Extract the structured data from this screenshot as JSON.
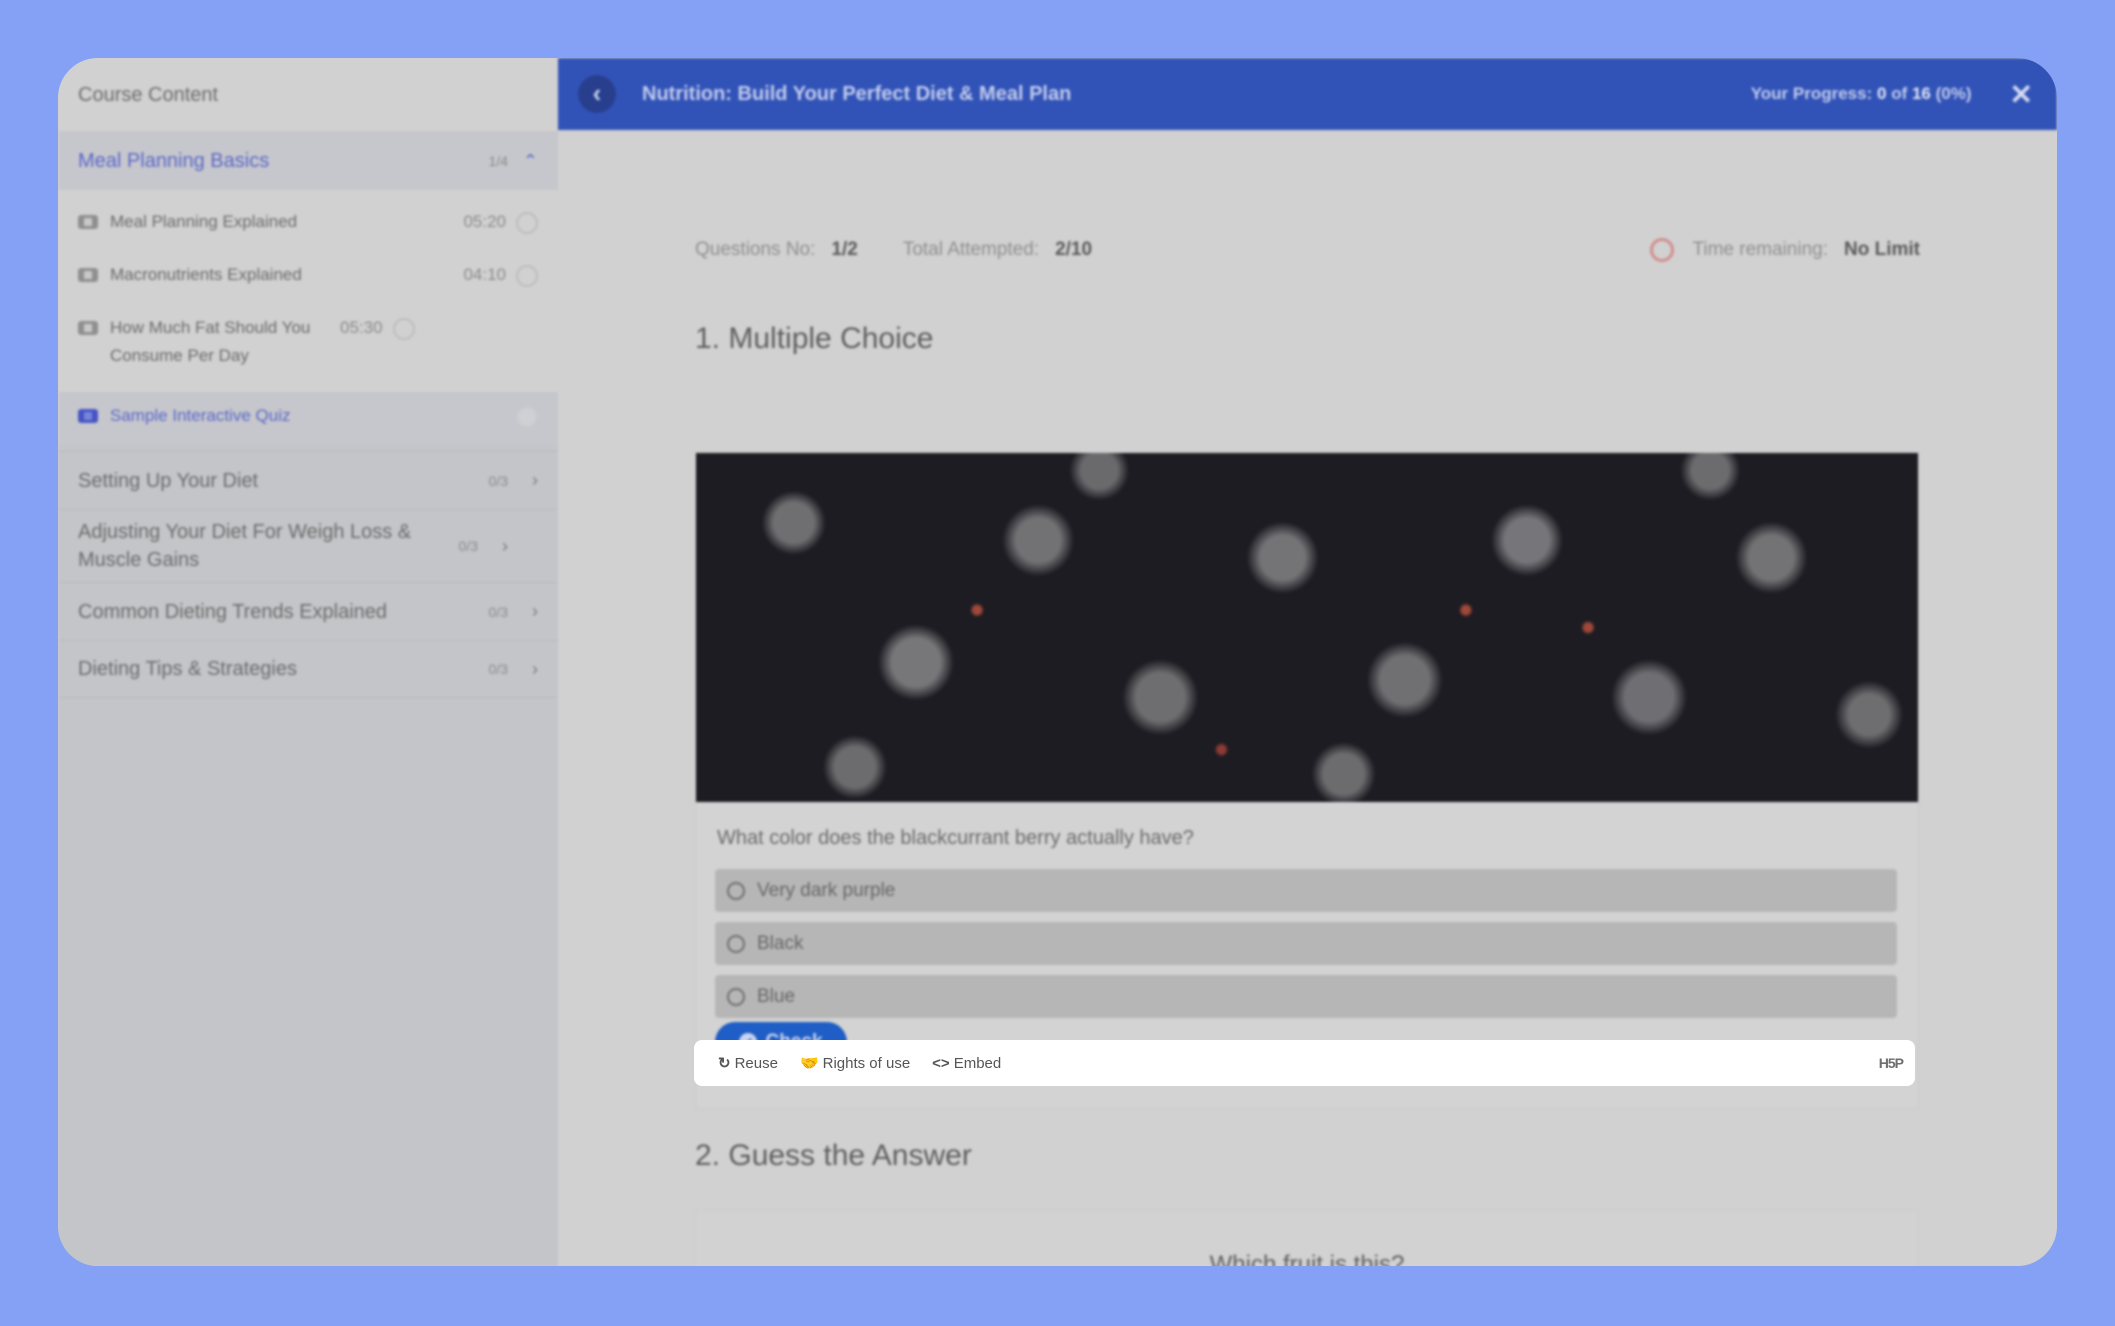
{
  "sidebar": {
    "title": "Course Content",
    "sections": [
      {
        "label": "Meal Planning Basics",
        "count": "1/4",
        "expanded": true,
        "items": [
          {
            "label": "Meal Planning Explained",
            "duration": "05:20",
            "icon": "video-icon"
          },
          {
            "label": "Macronutrients Explained",
            "duration": "04:10",
            "icon": "video-icon"
          },
          {
            "label": "How Much Fat Should You Consume Per Day",
            "duration": "05:30",
            "icon": "video-icon"
          },
          {
            "label": "Sample Interactive Quiz",
            "duration": "",
            "icon": "quiz-icon",
            "active": true
          }
        ]
      },
      {
        "label": "Setting Up Your Diet",
        "count": "0/3"
      },
      {
        "label": "Adjusting Your Diet For Weigh Loss & Muscle Gains",
        "count": "0/3"
      },
      {
        "label": "Common Dieting Trends Explained",
        "count": "0/3"
      },
      {
        "label": "Dieting Tips & Strategies",
        "count": "0/3"
      }
    ]
  },
  "header": {
    "title": "Nutrition: Build Your Perfect Diet & Meal Plan",
    "progress_label": "Your Progress:",
    "progress_done": "0",
    "progress_of": "of",
    "progress_total": "16",
    "progress_percent": "(0%)",
    "accent_color": "#3153b7"
  },
  "quiz": {
    "questions_label": "Questions No:",
    "questions_value": "1/2",
    "attempted_label": "Total Attempted:",
    "attempted_value": "2/10",
    "time_label": "Time remaining:",
    "time_value": "No Limit",
    "q1": {
      "title": "1. Multiple Choice",
      "image_alt": "blackcurrant berries",
      "question": "What color does the blackcurrant berry actually have?",
      "options": [
        "Very dark purple",
        "Black",
        "Blue"
      ],
      "check_label": "Check"
    },
    "h5p_footer": {
      "reuse": "Reuse",
      "rights": "Rights of use",
      "embed": "Embed",
      "logo": "H5P"
    },
    "q2": {
      "title": "2. Guess the Answer",
      "question": "Which fruit is this?"
    }
  }
}
